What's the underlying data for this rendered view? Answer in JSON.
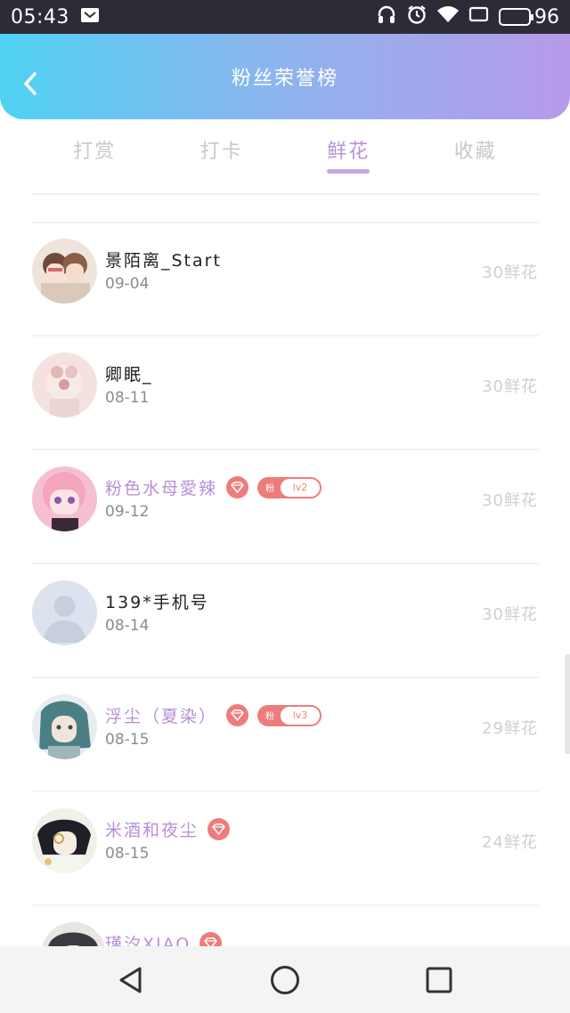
{
  "statusbar": {
    "time": "05:43",
    "battery": "96",
    "battery_level": 0.96
  },
  "header": {
    "title": "粉丝荣誉榜"
  },
  "tabs": [
    {
      "label": "打赏",
      "active": false
    },
    {
      "label": "打卡",
      "active": false
    },
    {
      "label": "鲜花",
      "active": true
    },
    {
      "label": "收藏",
      "active": false
    }
  ],
  "rows": [
    {
      "name": "景陌离_Start",
      "date": "09-04",
      "score": "30鲜花",
      "vip": false
    },
    {
      "name": "卿眠_",
      "date": "08-11",
      "score": "30鲜花",
      "vip": false
    },
    {
      "name": "粉色水母愛辣",
      "date": "09-12",
      "score": "30鲜花",
      "vip": true,
      "fan_tag": "粉",
      "level": "lv2"
    },
    {
      "name": "139*手机号",
      "date": "08-14",
      "score": "30鲜花",
      "vip": false
    },
    {
      "name": "浮尘（夏染）",
      "date": "08-15",
      "score": "29鲜花",
      "vip": true,
      "fan_tag": "粉",
      "level": "lv3"
    },
    {
      "name": "米酒和夜尘",
      "date": "08-15",
      "score": "24鲜花",
      "vip": true
    },
    {
      "name": "瑾汐XIAO",
      "date": "",
      "score": "",
      "vip": true
    }
  ],
  "colors": {
    "accent": "#b993d8",
    "badge": "#ef7c7c",
    "header_start": "#4fd2f3",
    "header_end": "#b69aea"
  }
}
